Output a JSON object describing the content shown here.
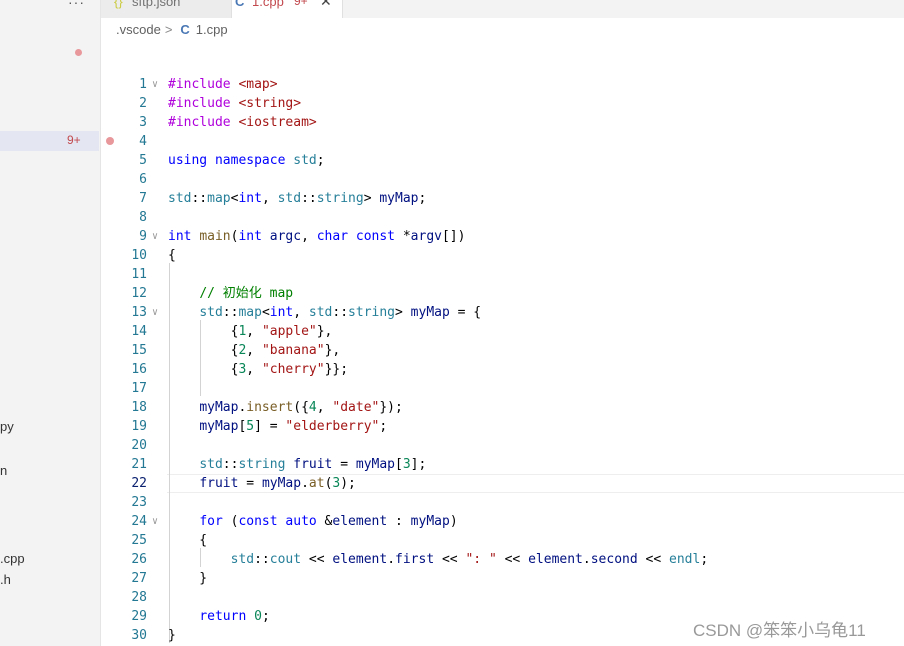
{
  "sidebar": {
    "more_icon": "···",
    "badge": "9+",
    "items": [
      {
        "label": "py"
      },
      {
        "label": "n"
      },
      {
        "label": ".cpp"
      },
      {
        "label": ".h"
      }
    ]
  },
  "tabs": [
    {
      "icon": "{}",
      "label": "sftp.json"
    },
    {
      "icon": "C",
      "label": "1.cpp",
      "badge": "9+",
      "close": "✕"
    }
  ],
  "breadcrumb": {
    "folder": ".vscode",
    "separator": ">",
    "file_icon": "C",
    "file": "1.cpp"
  },
  "editor": {
    "active_line": 22,
    "line_numbers": [
      "1",
      "2",
      "3",
      "4",
      "5",
      "6",
      "7",
      "8",
      "9",
      "10",
      "11",
      "12",
      "13",
      "14",
      "15",
      "16",
      "17",
      "18",
      "19",
      "20",
      "21",
      "22",
      "23",
      "24",
      "25",
      "26",
      "27",
      "28",
      "29",
      "30"
    ],
    "lines": [
      "#include <map>",
      "#include <string>",
      "#include <iostream>",
      "",
      "using namespace std;",
      "",
      "std::map<int, std::string> myMap;",
      "",
      "int main(int argc, char const *argv[])",
      "{",
      "",
      "    // 初始化 map",
      "    std::map<int, std::string> myMap = {",
      "        {1, \"apple\"},",
      "        {2, \"banana\"},",
      "        {3, \"cherry\"}};",
      "",
      "    myMap.insert({4, \"date\"});",
      "    myMap[5] = \"elderberry\";",
      "",
      "    std::string fruit = myMap[3];",
      "    fruit = myMap.at(3);",
      "",
      "    for (const auto &element : myMap)",
      "    {",
      "        std::cout << element.first << \": \" << element.second << endl;",
      "    }",
      "",
      "    return 0;",
      "}"
    ]
  },
  "watermark": "CSDN @笨笨小乌龟11",
  "colors": {
    "keyword": "#0000ff",
    "preprocessor": "#af00db",
    "type": "#267f99",
    "string": "#a31515",
    "comment": "#008000",
    "number": "#098658",
    "variable": "#001080",
    "function": "#795e26",
    "line_number": "#237893"
  }
}
